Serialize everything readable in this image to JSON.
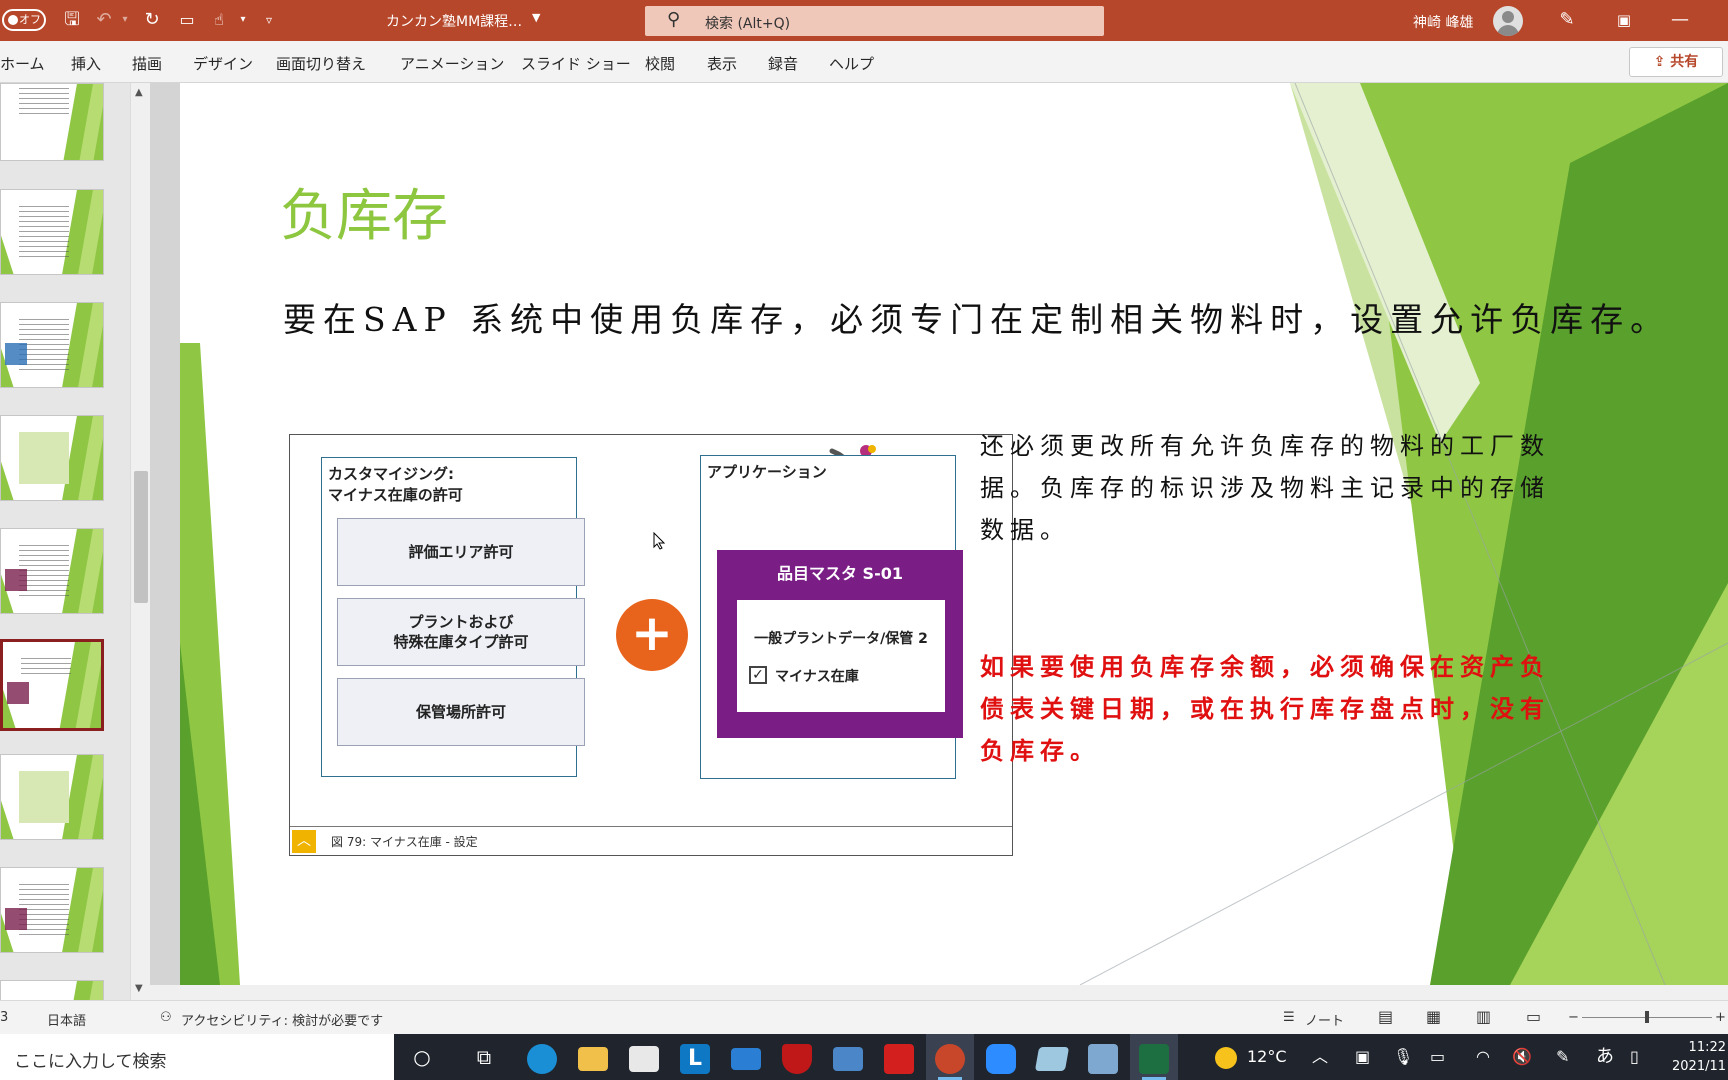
{
  "titlebar": {
    "autosave_label": "オフ",
    "doc_title": "カンカン塾MM課程…",
    "search_placeholder": "検索 (Alt+Q)",
    "user_name": "神崎 峰雄"
  },
  "ribbon": {
    "tabs": [
      "ホーム",
      "挿入",
      "描画",
      "デザイン",
      "画面切り替え",
      "アニメーション",
      "スライド ショー",
      "校閲",
      "表示",
      "録音",
      "ヘルプ"
    ],
    "share_label": "共有"
  },
  "slide": {
    "title": "负库存",
    "main_text": "要在SAP 系统中使用负库存，必须专门在定制相关物料时，设置允许负库存。",
    "side_text": "还必须更改所有允许负库存的物料的工厂数据。负库存的标识涉及物料主记录中的存储数据。",
    "red_text": "如果要使用负库存余额，必须确保在资产负债表关键日期，或在执行库存盘点时，没有负库存。",
    "accent_color": "#8dc63f",
    "warning_color": "#e01010"
  },
  "figure": {
    "left_box_title": "カスタマイジング:",
    "left_box_subtitle": "マイナス在庫の許可",
    "perm_items": [
      "評価エリア許可",
      "プラントおよび",
      "特殊在庫タイプ許可",
      "保管場所許可"
    ],
    "plus_symbol": "+",
    "right_box_title": "アプリケーション",
    "master_title": "品目マスタ S-01",
    "master_section": "一般プラントデータ/保管 2",
    "checkbox_label": "マイナス在庫",
    "checkbox_checked": true,
    "checkbox_mark": "✓",
    "caption": "図 79: マイナス在庫 - 設定",
    "purple_color": "#7a1e86"
  },
  "status": {
    "slide_num": "3",
    "language": "日本語",
    "accessibility": "アクセシビリティ: 検討が必要です",
    "notes_label": "ノート"
  },
  "taskbar": {
    "search_placeholder": "ここに入力して検索",
    "temperature": "12°C",
    "ime": "あ",
    "time": "11:22",
    "date": "2021/11"
  }
}
